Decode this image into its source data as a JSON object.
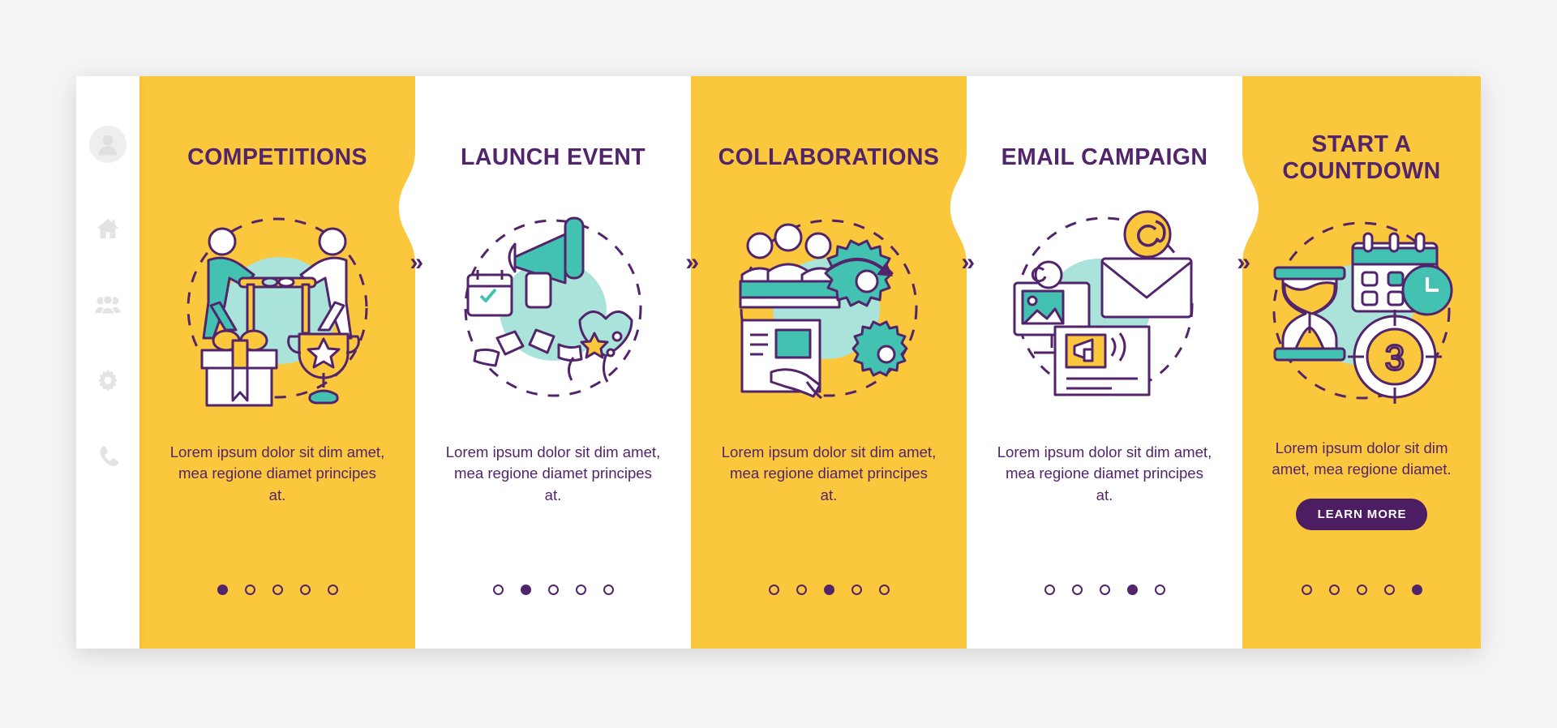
{
  "colors": {
    "yellow": "#fbc73c",
    "purple": "#52246b",
    "button_purple": "#4c1d63",
    "teal": "#43c2b1",
    "teal_light": "#a9e3da",
    "page_bg": "#f4f4f4",
    "white": "#ffffff",
    "sidebar_icon": "#e3e3e3"
  },
  "sidebar": {
    "items": [
      {
        "icon": "avatar-icon",
        "label": "Profile"
      },
      {
        "icon": "home-icon",
        "label": "Home"
      },
      {
        "icon": "people-icon",
        "label": "Contacts"
      },
      {
        "icon": "gear-icon",
        "label": "Settings"
      },
      {
        "icon": "phone-icon",
        "label": "Call"
      }
    ]
  },
  "separator": {
    "chevron": "»"
  },
  "cards": [
    {
      "title": "COMPETITIONS",
      "description": "Lorem ipsum dolor sit dim amet, mea regione diamet principes at.",
      "illustration": "competition-illustration",
      "background": "yellow",
      "dots": {
        "count": 5,
        "active_index": 0
      },
      "button": null
    },
    {
      "title": "LAUNCH EVENT",
      "description": "Lorem ipsum dolor sit dim amet, mea regione diamet principes at.",
      "illustration": "launch-event-illustration",
      "background": "white",
      "dots": {
        "count": 5,
        "active_index": 1
      },
      "button": null
    },
    {
      "title": "COLLABORATIONS",
      "description": "Lorem ipsum dolor sit dim amet, mea regione diamet principes at.",
      "illustration": "collaboration-illustration",
      "background": "yellow",
      "dots": {
        "count": 5,
        "active_index": 2
      },
      "button": null
    },
    {
      "title": "EMAIL CAMPAIGN",
      "description": "Lorem ipsum dolor sit dim amet, mea regione diamet principes at.",
      "illustration": "email-campaign-illustration",
      "background": "white",
      "dots": {
        "count": 5,
        "active_index": 3
      },
      "button": null
    },
    {
      "title": "START A COUNTDOWN",
      "description": "Lorem ipsum dolor sit dim amet, mea regione diamet.",
      "illustration": "countdown-illustration",
      "background": "yellow",
      "dots": {
        "count": 5,
        "active_index": 4
      },
      "button": "LEARN MORE"
    }
  ]
}
